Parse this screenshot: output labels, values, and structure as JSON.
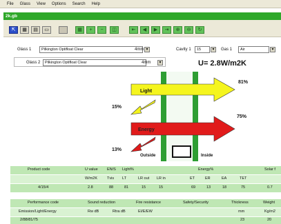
{
  "menu": [
    "File",
    "Glass",
    "View",
    "Options",
    "Search",
    "Help"
  ],
  "window": {
    "title": "2k.gb"
  },
  "row1": {
    "glass1_label": "Glass 1",
    "glass1_value": "Pilkington Optifloat Clear",
    "glass1_thickness": "4mm",
    "cavity_label": "Cavity 1",
    "cavity_value": "15",
    "gas_label": "Gas 1",
    "gas_value": "Air"
  },
  "row2": {
    "glass2_label": "Glass 2",
    "glass2_value": "Pilkington Optifloat Clear",
    "glass2_thickness": "4mm"
  },
  "uvalue": "U= 2.8W/m2K",
  "diagram": {
    "light_label": "Light",
    "energy_label": "Energy",
    "light_transmitted": "81%",
    "light_reflected": "15%",
    "energy_transmitted": "75%",
    "energy_reflected": "13%",
    "outside_label": "Outside",
    "inside_label": "Inside"
  },
  "table1": {
    "headers": [
      "Product code",
      "U value",
      "EN/S",
      "Light%",
      "Energy%",
      "Solar f"
    ],
    "subheaders": [
      "W/m2K",
      "Tvis",
      "LT",
      "LR out",
      "LR in",
      "ET",
      "ER",
      "EA",
      "TET",
      ""
    ],
    "values": [
      "4/15/4",
      "2.8",
      "88",
      "81",
      "15",
      "15",
      "69",
      "13",
      "18",
      "75",
      "0.7"
    ]
  },
  "table2": {
    "headers": [
      "Performance code",
      "Sound reduction",
      "Fire resistance",
      "Safety/Security",
      "Thickness",
      "Weight"
    ],
    "subheaders": [
      "Emission/Light/Energy",
      "Rw dB",
      "Rtra dB",
      "EI/E/EW",
      "",
      "mm",
      "Kg/m2"
    ],
    "values": [
      "2/88/81/75",
      "",
      "",
      "",
      "",
      "23",
      "20"
    ]
  },
  "colors": {
    "title_green": "#2fa82a",
    "light_arrow": "#f5f51e",
    "energy_arrow": "#e11b1b",
    "glass_green": "#2e9e33",
    "table_green": "#bfe7b4"
  }
}
